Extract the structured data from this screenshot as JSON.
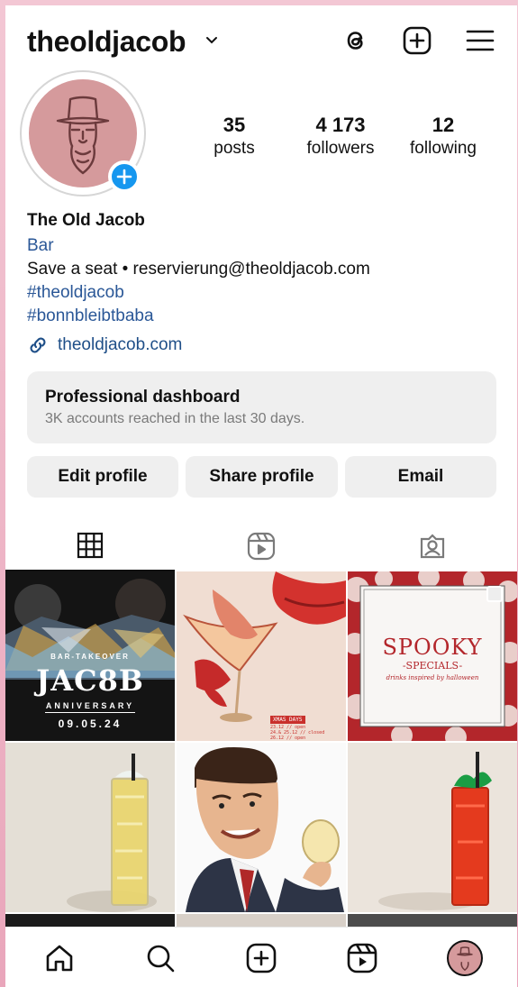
{
  "header": {
    "username": "theoldjacob",
    "icons": [
      "threads-icon",
      "new-post-icon",
      "menu-icon"
    ]
  },
  "profile": {
    "stats": [
      {
        "value": "35",
        "label": "posts"
      },
      {
        "value": "4 173",
        "label": "followers"
      },
      {
        "value": "12",
        "label": "following"
      }
    ],
    "name": "The Old Jacob",
    "category": "Bar",
    "bio_line": "Save a seat • reservierung@theoldjacob.com",
    "hashtags": [
      "#theoldjacob",
      "#bonnbleibtbaba"
    ],
    "link": "theoldjacob.com"
  },
  "dashboard": {
    "title": "Professional dashboard",
    "subtitle": "3K accounts reached in the last 30 days."
  },
  "buttons": {
    "edit": "Edit profile",
    "share": "Share profile",
    "email": "Email"
  },
  "tabs": [
    "grid-tab",
    "reels-tab",
    "tagged-tab"
  ],
  "posts": {
    "p1": {
      "line1": "BAR-TAKEOVER",
      "big": "JAC8B",
      "line2": "ANNIVERSARY",
      "date": "09.05.24"
    },
    "p2": {
      "title": "XMAS DAYS",
      "line1": "23.12 // open",
      "line2": "24.& 25.12 // closed",
      "line3": "26.12 // open"
    },
    "p3": {
      "big": "SPOOKY",
      "sub": "-SPECIALS-",
      "small": "drinks inspired by halloween"
    }
  },
  "colors": {
    "accent_blue": "#1697ef",
    "link_blue": "#2a5797",
    "avatar_bg": "#d59a9c",
    "spooky_red": "#b3262b"
  },
  "nav": [
    "home-icon",
    "search-icon",
    "create-icon",
    "reels-icon",
    "profile-avatar"
  ]
}
